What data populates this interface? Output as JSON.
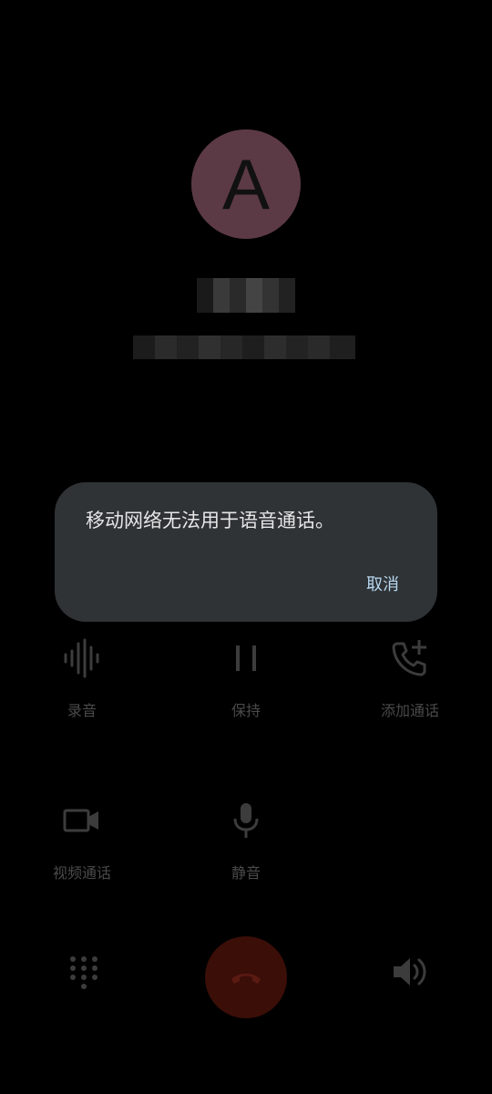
{
  "caller": {
    "avatar_letter": "A",
    "avatar_color": "#5c3a45"
  },
  "controls": {
    "record": {
      "label": "录音",
      "icon": "waveform-icon"
    },
    "hold": {
      "label": "保持",
      "icon": "pause-icon"
    },
    "add_call": {
      "label": "添加通话",
      "icon": "add-call-icon"
    },
    "video_call": {
      "label": "视频通话",
      "icon": "videocam-icon"
    },
    "mute": {
      "label": "静音",
      "icon": "mic-icon"
    }
  },
  "bottom": {
    "dialpad_icon": "dialpad-icon",
    "hangup_icon": "call-end-icon",
    "speaker_icon": "volume-icon",
    "hangup_color": "#3b0e08"
  },
  "dialog": {
    "message": "移动网络无法用于语音通话。",
    "cancel_label": "取消",
    "accent": "#b7d7ef"
  }
}
